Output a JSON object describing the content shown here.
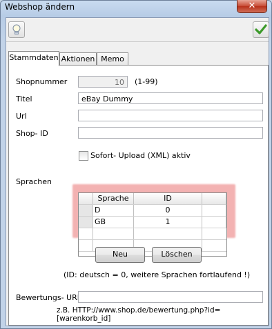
{
  "window": {
    "title": "Webshop ändern",
    "close_label": "✕"
  },
  "tabs": [
    {
      "label": "Stammdaten",
      "active": true
    },
    {
      "label": "Aktionen",
      "active": false
    },
    {
      "label": "Memo",
      "active": false
    }
  ],
  "form": {
    "shopnummer_label": "Shopnummer",
    "shopnummer_value": "10",
    "shopnummer_range": "(1-99)",
    "titel_label": "Titel",
    "titel_value": "eBay Dummy",
    "url_label": "Url",
    "url_value": "",
    "shopid_label": "Shop- ID",
    "shopid_value": "",
    "sofort_label": "Sofort- Upload (XML) aktiv",
    "sofort_checked": false,
    "sprachen_label": "Sprachen",
    "bewertung_label": "Bewertungs- URL",
    "bewertung_value": "",
    "bewertung_hint": "z.B. HTTP://www.shop.de/bewertung.php?id=[warenkorb_id]"
  },
  "grid": {
    "columns": [
      "Sprache",
      "ID"
    ],
    "rows": [
      {
        "sprache": "D",
        "id": "0"
      },
      {
        "sprache": "GB",
        "id": "1"
      }
    ]
  },
  "buttons": {
    "neu": "Neu",
    "loeschen": "Löschen"
  },
  "info_text": "(ID: deutsch = 0, weitere Sprachen fortlaufend !)",
  "colors": {
    "highlight": "#e45454",
    "confirm": "#3c9a2a"
  }
}
